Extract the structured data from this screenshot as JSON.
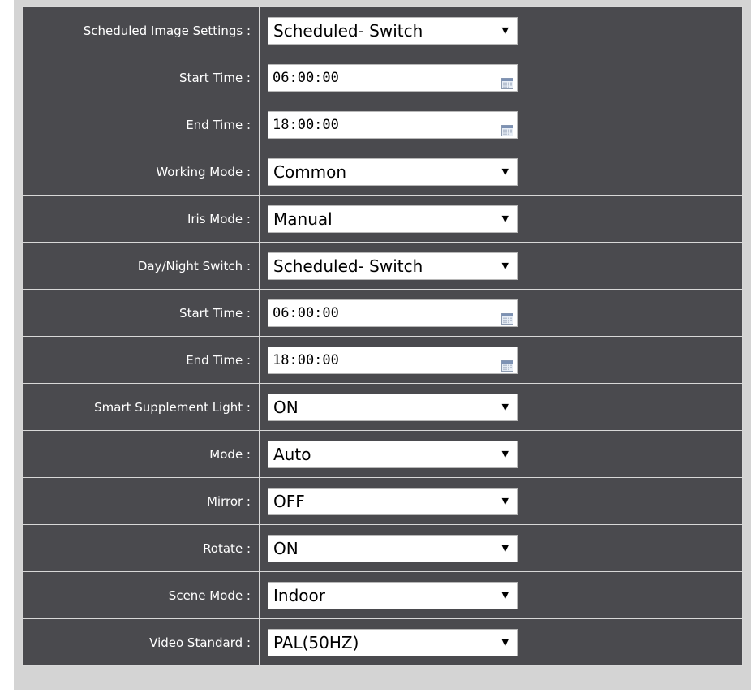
{
  "rows": [
    {
      "label": "Scheduled Image Settings :",
      "type": "select",
      "value": "Scheduled- Switch"
    },
    {
      "label": "Start Time :",
      "type": "time",
      "value": "06:00:00"
    },
    {
      "label": "End Time :",
      "type": "time",
      "value": "18:00:00"
    },
    {
      "label": "Working Mode :",
      "type": "select",
      "value": "Common"
    },
    {
      "label": "Iris Mode :",
      "type": "select",
      "value": "Manual"
    },
    {
      "label": "Day/Night Switch :",
      "type": "select",
      "value": "Scheduled- Switch"
    },
    {
      "label": "Start Time :",
      "type": "time",
      "value": "06:00:00"
    },
    {
      "label": "End Time :",
      "type": "time",
      "value": "18:00:00"
    },
    {
      "label": "Smart Supplement Light :",
      "type": "select",
      "value": "ON"
    },
    {
      "label": "Mode :",
      "type": "select",
      "value": "Auto"
    },
    {
      "label": "Mirror :",
      "type": "select",
      "value": "OFF"
    },
    {
      "label": "Rotate :",
      "type": "select",
      "value": "ON"
    },
    {
      "label": "Scene Mode :",
      "type": "select",
      "value": "Indoor"
    },
    {
      "label": "Video Standard :",
      "type": "select",
      "value": "PAL(50HZ)"
    }
  ],
  "icons": {
    "dropdown": "chevron-down-icon",
    "calendar": "calendar-icon"
  },
  "colors": {
    "row_background": "#4a4a4e",
    "panel_background": "#d4d4d4",
    "label_text": "#ffffff"
  }
}
